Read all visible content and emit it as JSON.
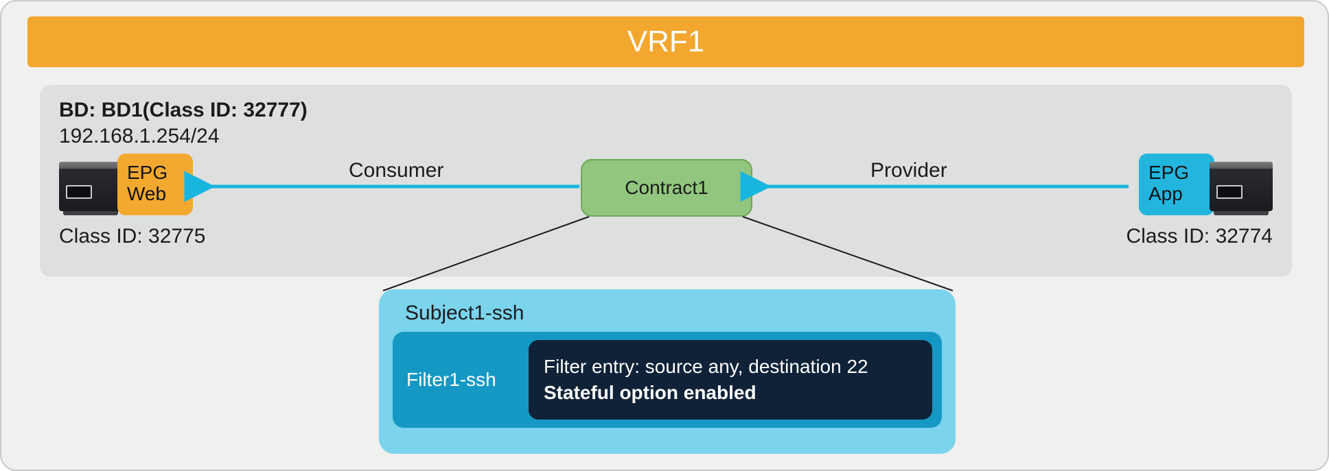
{
  "vrf": {
    "title": "VRF1"
  },
  "bd": {
    "title": "BD: BD1(Class ID: 32777)",
    "subnet": "192.168.1.254/24"
  },
  "epg_web": {
    "line1": "EPG",
    "line2": "Web",
    "class_id": "Class ID: 32775"
  },
  "epg_app": {
    "line1": "EPG",
    "line2": "App",
    "class_id": "Class ID: 32774"
  },
  "contract": {
    "name": "Contract1"
  },
  "relations": {
    "consumer": "Consumer",
    "provider": "Provider"
  },
  "subject": {
    "name": "Subject1-ssh",
    "filter_name": "Filter1-ssh",
    "entry_line1": "Filter entry: source any, destination 22",
    "entry_line2": "Stateful option enabled"
  }
}
